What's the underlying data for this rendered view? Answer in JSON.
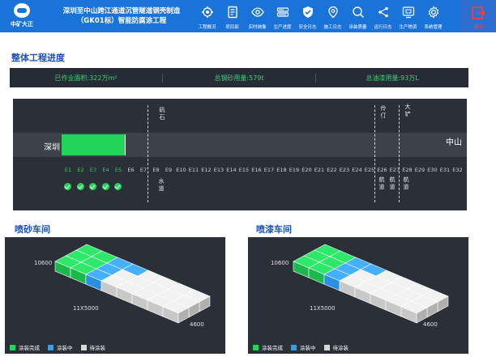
{
  "header": {
    "logo_text": "中矿大正",
    "title_line1": "深圳至中山跨江通道沉管隧道钢壳制造",
    "title_line2": "（GK01标）智能防腐涂工程",
    "nav": [
      {
        "label": "工程概况",
        "icon": "settings-gear-people-icon"
      },
      {
        "label": "项目部",
        "icon": "document-icon"
      },
      {
        "label": "实时映像",
        "icon": "eye-icon"
      },
      {
        "label": "生产进度",
        "icon": "progress-icon"
      },
      {
        "label": "安全日志",
        "icon": "shield-check-icon"
      },
      {
        "label": "施工日志",
        "icon": "location-pin-icon"
      },
      {
        "label": "涂装质量",
        "icon": "search-icon"
      },
      {
        "label": "运行日志",
        "icon": "share-icon"
      },
      {
        "label": "生产物资",
        "icon": "monitor-icon"
      },
      {
        "label": "系统管理",
        "icon": "gear-icon"
      }
    ],
    "logout_label": "退出"
  },
  "overall": {
    "title": "整体工程进度",
    "stats": [
      "已作业面积:322万m²",
      "总钢砂用量:579t",
      "总油漆用量:93万L"
    ]
  },
  "tunnel": {
    "start_label": "深圳",
    "end_label": "中山",
    "segments": [
      "E1",
      "E2",
      "E3",
      "E4",
      "E5",
      "E6",
      "E7",
      "E8",
      "E9",
      "E10",
      "E11",
      "E12",
      "E13",
      "E14",
      "E15",
      "E16",
      "E17",
      "E18",
      "E19",
      "E20",
      "E21",
      "E22",
      "E23",
      "E24",
      "E25",
      "E26",
      "E27",
      "E28",
      "E29",
      "E30",
      "E31",
      "E32"
    ],
    "completed_count": 5,
    "annotations_top": [
      "矾石",
      "伶仃",
      "大铲"
    ],
    "annotations_bottom": [
      "水道",
      "航道",
      "航道",
      "航道"
    ]
  },
  "workshops": [
    {
      "title": "喷砂车间",
      "height_label": "10600",
      "length_label": "11X5000",
      "width_label": "4600",
      "legend": [
        "涂装完成",
        "涂装中",
        "待涂装"
      ]
    },
    {
      "title": "喷漆车间",
      "height_label": "10600",
      "length_label": "11X5000",
      "width_label": "4600",
      "legend": [
        "涂装完成",
        "涂装中",
        "待涂装"
      ]
    }
  ],
  "colors": {
    "done": "#22d45a",
    "in_progress": "#2f9ff0",
    "pending": "#d8d8d8"
  }
}
